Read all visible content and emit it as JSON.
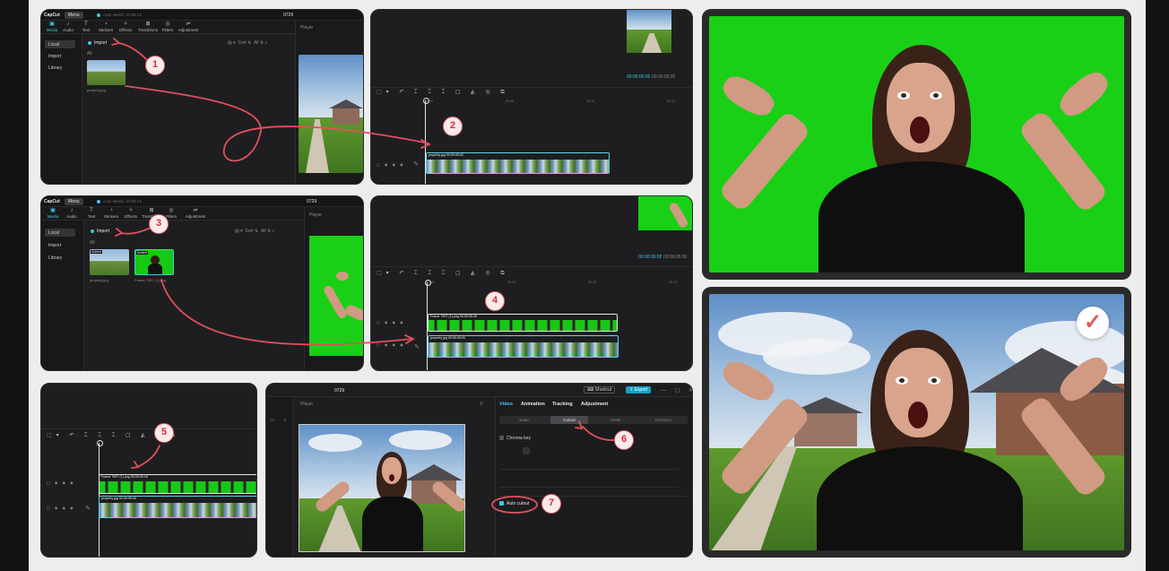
{
  "app": {
    "logo": "CapCut",
    "menu_label": "Menu",
    "autosave": "Auto saved: 10:58:13"
  },
  "toolbar": {
    "tabs": [
      {
        "label": "Media",
        "icon": "media-icon"
      },
      {
        "label": "Audio",
        "icon": "audio-icon"
      },
      {
        "label": "Text",
        "icon": "text-icon"
      },
      {
        "label": "Stickers",
        "icon": "sticker-icon"
      },
      {
        "label": "Effects",
        "icon": "effects-icon"
      },
      {
        "label": "Transitions",
        "icon": "transitions-icon"
      },
      {
        "label": "Filters",
        "icon": "filters-icon"
      },
      {
        "label": "Adjustment",
        "icon": "adjustment-icon"
      }
    ]
  },
  "sidebar": {
    "items": [
      "Local",
      "Import",
      "Library"
    ]
  },
  "media": {
    "import_label": "Import",
    "all_label": "All",
    "sort_label": "Sort",
    "all_filter": "All",
    "files": [
      {
        "name": "property.jpg",
        "badge": "Added"
      },
      {
        "name": "Frame 7957 (1).png",
        "badge": "Added"
      }
    ]
  },
  "player": {
    "label": "Player",
    "project_title": "0729",
    "time_current": "00:00:00:00",
    "time_total": "00:00:05:00"
  },
  "timeline": {
    "ruler": [
      "00:00",
      "00:05",
      "00:10",
      "00:15"
    ],
    "clips": [
      {
        "label": "Frame 7957 (1).png  00:00:05:28"
      },
      {
        "label": "property.jpg  00:00:05:00"
      }
    ]
  },
  "properties": {
    "main_tabs": [
      "Video",
      "Animation",
      "Tracking",
      "Adjustment"
    ],
    "sub_tabs": [
      "Basic",
      "Cutout",
      "Mask",
      "Enhance"
    ],
    "selected_sub_tab": "Cutout",
    "chroma_key": "Chroma key",
    "auto_cutout": "Auto cutout",
    "shortcut_label": "Shortcut",
    "export_label": "Export"
  },
  "steps": [
    "1",
    "2",
    "3",
    "4",
    "5",
    "6",
    "7"
  ],
  "colors": {
    "accent": "#3fc7e6",
    "badge_border": "#e0646d",
    "green_screen": "#19d016",
    "arrow": "#e0505c",
    "page_bg": "#ededed"
  },
  "result_icon": "checkmark-icon"
}
